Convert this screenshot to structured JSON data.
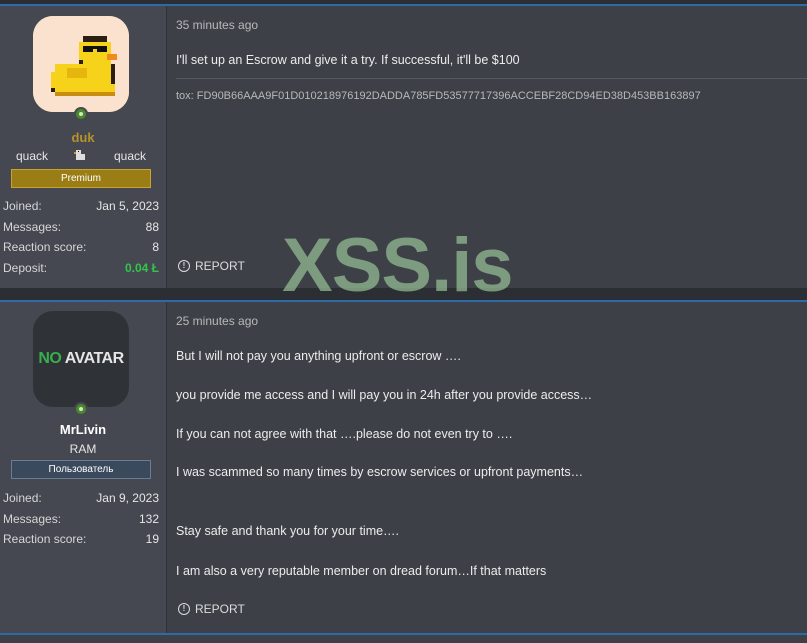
{
  "watermark": "XSS.is",
  "posts": [
    {
      "user": {
        "name": "duk",
        "title_left": "quack",
        "title_right": "quack",
        "banner": "Premium",
        "stats": [
          {
            "label": "Joined:",
            "value": "Jan 5, 2023"
          },
          {
            "label": "Messages:",
            "value": "88"
          },
          {
            "label": "Reaction score:",
            "value": "8"
          },
          {
            "label": "Deposit:",
            "value": "0.04 Ł"
          }
        ]
      },
      "time": "35 minutes ago",
      "messages": [
        "I'll set up an Escrow and give it a try. If successful, it'll be $100"
      ],
      "signature": "tox: FD90B66AAA9F01D010218976192DADDA785FD53577717396ACCEBF28CD94ED38D453BB163897",
      "report": "REPORT"
    },
    {
      "user": {
        "name": "MrLivin",
        "avatar_text_no": "NO",
        "avatar_text_rest": "AVATAR",
        "title": "RAM",
        "banner": "Пользователь",
        "stats": [
          {
            "label": "Joined:",
            "value": "Jan 9, 2023"
          },
          {
            "label": "Messages:",
            "value": "132"
          },
          {
            "label": "Reaction score:",
            "value": "19"
          }
        ]
      },
      "time": "25 minutes ago",
      "messages": [
        "But I will not pay you anything upfront or escrow ….",
        "you provide me access and I will pay you in 24h after you provide access…",
        "If you can not agree with that ….please do not even try to ….",
        "I was scammed so many times by escrow services or upfront payments…",
        "Stay safe and thank you for your time….",
        "I am also a very reputable member on dread forum…If that matters"
      ],
      "report": "REPORT"
    }
  ],
  "colors": {
    "accent_border": "#2f6aa8",
    "premium": "#9a7d14",
    "username_duk": "#b8912a",
    "deposit_green": "#34c44a",
    "no_avatar_green": "#35b04a"
  }
}
